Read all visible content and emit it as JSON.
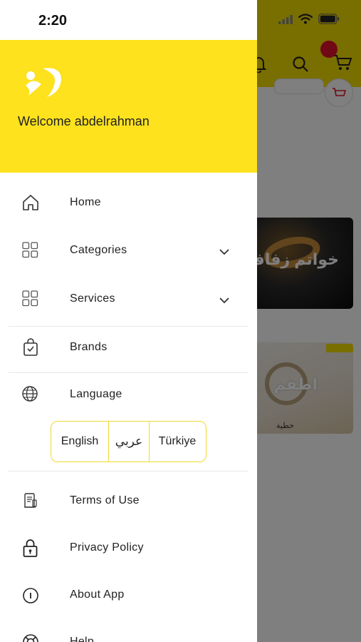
{
  "status_bar": {
    "time": "2:20"
  },
  "drawer": {
    "welcome_text": "Welcome abdelrahman",
    "menu": [
      {
        "label": "Home",
        "icon": "home-icon"
      },
      {
        "label": "Categories",
        "icon": "grid-icon",
        "expandable": true
      },
      {
        "label": "Services",
        "icon": "grid-icon",
        "expandable": true
      },
      {
        "label": "Brands",
        "icon": "shopping-bag-icon"
      },
      {
        "label": "Language",
        "icon": "globe-icon"
      },
      {
        "label": "Terms of Use",
        "icon": "document-icon"
      },
      {
        "label": "Privacy Policy",
        "icon": "lock-icon"
      },
      {
        "label": "About App",
        "icon": "info-icon"
      },
      {
        "label": "Help",
        "icon": "lifebuoy-icon"
      }
    ],
    "languages": [
      "English",
      "عربي",
      "Türkiye"
    ]
  },
  "background": {
    "card1_label": "خواتم زفاف",
    "card2_label": "اطقم",
    "card2_caption": "خطية"
  },
  "colors": {
    "accent_yellow": "#fde21d",
    "badge_red": "#e3102a"
  }
}
